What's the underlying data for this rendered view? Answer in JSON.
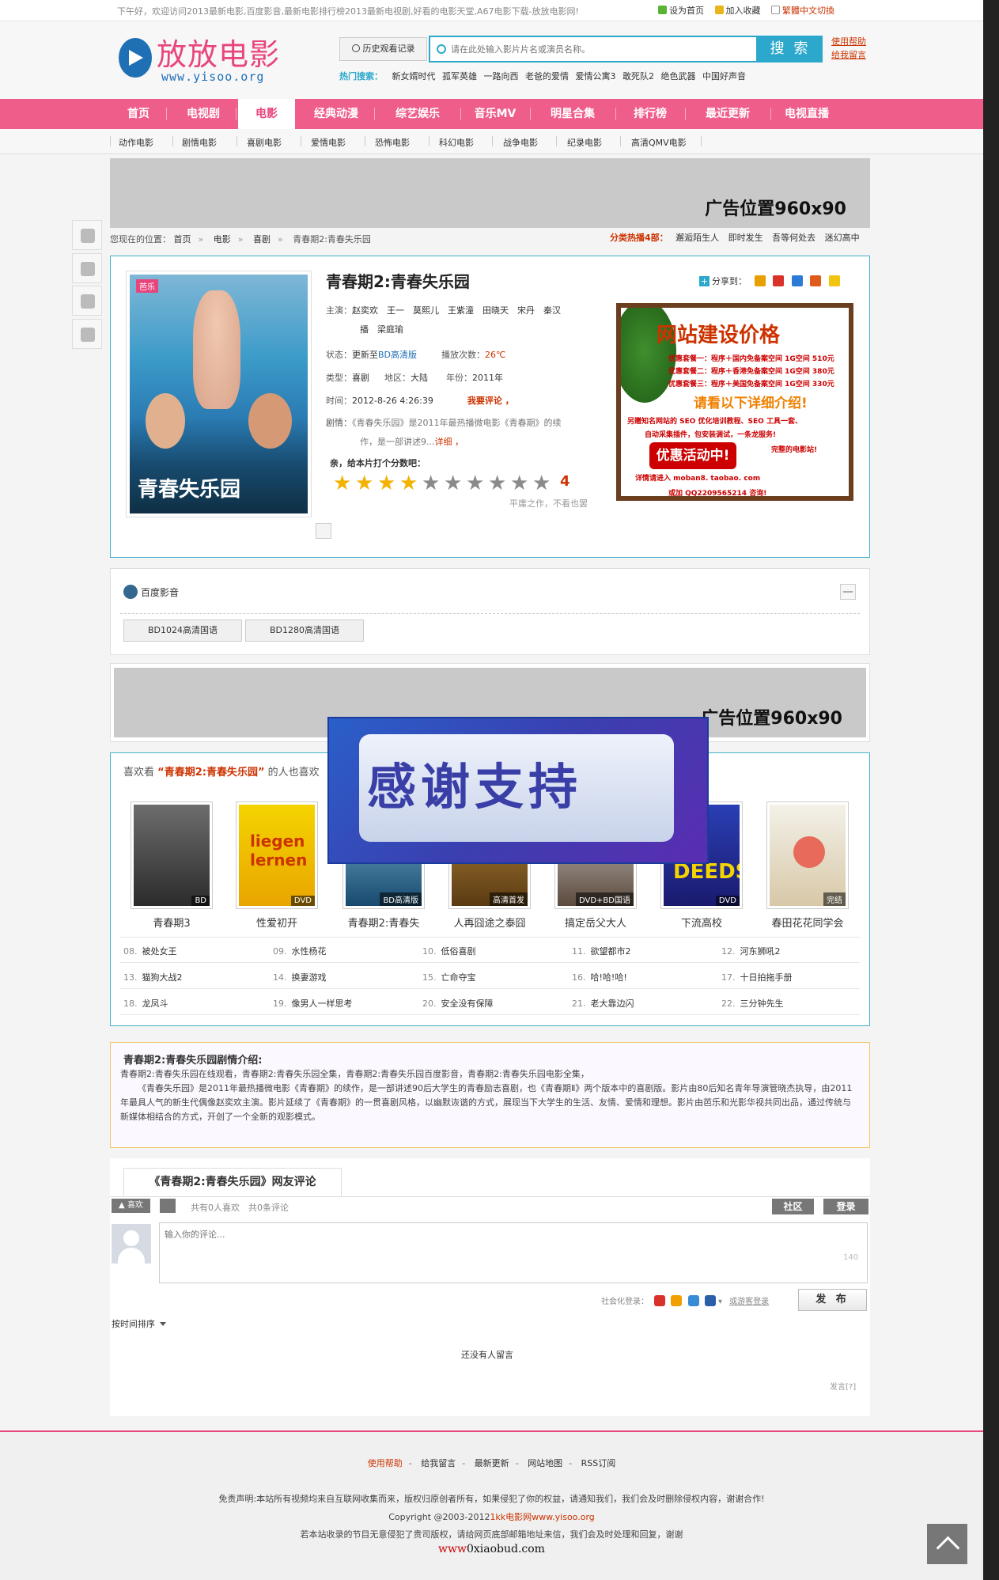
{
  "topbar": {
    "greeting": "下午好，欢迎访问2013最新电影,百度影音,最新电影排行榜2013最新电视剧,好看的电影天堂,A67电影下载-放放电影网!",
    "set_home": "设为首页",
    "add_fav": "加入收藏",
    "trad": "繁體中文切換"
  },
  "header": {
    "logo_name": "放放电影",
    "logo_url": "www.yisoo.org",
    "history_label": "历史观看记录",
    "search_placeholder": "请在此处输入影片片名或演员名称。",
    "search_button": "搜 索",
    "help": "使用帮助",
    "feedback": "给我留言",
    "hot_label": "热门搜索：",
    "hot_keywords": [
      "新女婿时代",
      "孤军英雄",
      "一路向西",
      "老爸的爱情",
      "爱情公寓3",
      "敢死队2",
      "绝色武器",
      "中国好声音"
    ]
  },
  "nav": {
    "items": [
      "首页",
      "电视剧",
      "电影",
      "经典动漫",
      "综艺娱乐",
      "音乐MV",
      "明星合集",
      "排行榜",
      "最近更新",
      "电视直播"
    ],
    "active": "电影"
  },
  "subnav": [
    "动作电影",
    "剧情电影",
    "喜剧电影",
    "爱情电影",
    "恐怖电影",
    "科幻电影",
    "战争电影",
    "纪录电影",
    "高清QMV电影"
  ],
  "ads": {
    "banner_text": "广告位置960x90"
  },
  "breadcrumb": {
    "prefix": "您现在的位置：",
    "items": [
      "首页",
      "电影",
      "喜剧",
      "青春期2:青春失乐园"
    ]
  },
  "hot_category": {
    "label": "分类热播4部：",
    "items": [
      "邂逅陌生人",
      "即时发生",
      "吾等何处去",
      "迷幻高中"
    ]
  },
  "movie": {
    "title": "青春期2:青春失乐园",
    "poster_title": "青春失乐园",
    "poster_badge": "芭乐",
    "share_label": "分享到：",
    "cast_label": "主演：",
    "cast_line1": "赵奕欢　王一　莫熙儿　王紫潼　田晓天　宋丹　秦汉",
    "cast_line2": "播　梁庭瑜",
    "status_label": "状态：",
    "status_prefix": "更新至",
    "status_value": "BD高清版",
    "plays_label": "播放次数：",
    "plays_value": "26℃",
    "type_label": "类型：",
    "type_value": "喜剧",
    "region_label": "地区：",
    "region_value": "大陆",
    "year_label": "年份：",
    "year_value": "2011年",
    "time_label": "时间：",
    "time_value": "2012-8-26 4:26:39",
    "comment_action": "我要评论 ，",
    "plot_label": "剧情：",
    "plot_short1": "《青春失乐园》是2011年最热播微电影《青春期》的续",
    "plot_short2": "作，是一部讲述9...",
    "detail_link": "详细 ，",
    "rate_prompt": "亲，给本片打个分数吧：",
    "rating": 4,
    "rating_max": 10,
    "score": "4",
    "rating_hint": "平庸之作，不看也罢"
  },
  "side_ad": {
    "headline": "网站建设价格",
    "lines": [
      "优惠套餐一：程序＋国内免备案空间 1G空间 510元",
      "优惠套餐二：程序＋香港免备案空间 1G空间 380元",
      "优惠套餐三：程序＋美国免备案空间 1G空间 330元"
    ],
    "headline2": "请看以下详细介绍!",
    "line4": "另赠知名网站的 SEO 优化培训教程、SEO 工具一套、",
    "line5": "自动采集插件，包安装调试，一条龙服务!",
    "burst": "优惠活动中!",
    "line6": "完整的电影站!",
    "line7": "详情请进入 moban8. taobao. com",
    "line8": "或加 QQ2209565214 咨询!"
  },
  "player": {
    "source_name": "百度影音",
    "collapse": "—",
    "sources": [
      "BD1024高清国语",
      "BD1280高清国语"
    ]
  },
  "overlay": {
    "text": "感谢支持"
  },
  "related": {
    "title_prefix": "喜欢看",
    "title_movie": "“青春期2:青春失乐园”",
    "title_suffix": "的人也喜欢",
    "posters": [
      {
        "name": "青春期3",
        "tag": "BD"
      },
      {
        "name": "性爱初开",
        "tag": "DVD"
      },
      {
        "name": "青春期2:青春失",
        "tag": "BD高清版"
      },
      {
        "name": "人再囧途之泰囧",
        "tag": "高清首发"
      },
      {
        "name": "搞定岳父大人",
        "tag": "DVD+BD国语"
      },
      {
        "name": "下流高校",
        "tag": "DVD"
      },
      {
        "name": "春田花花同学会",
        "tag": "完结"
      }
    ],
    "list": [
      {
        "n": "08.",
        "t": "被处女王"
      },
      {
        "n": "09.",
        "t": "水性杨花"
      },
      {
        "n": "10.",
        "t": "低俗喜剧"
      },
      {
        "n": "11.",
        "t": "欲望都市2"
      },
      {
        "n": "12.",
        "t": "河东狮吼2"
      },
      {
        "n": "13.",
        "t": "猫狗大战2"
      },
      {
        "n": "14.",
        "t": "换妻游戏"
      },
      {
        "n": "15.",
        "t": "亡命夺宝"
      },
      {
        "n": "16.",
        "t": "哈!哈!哈!"
      },
      {
        "n": "17.",
        "t": "十日拍拖手册"
      },
      {
        "n": "18.",
        "t": "龙凤斗"
      },
      {
        "n": "19.",
        "t": "像男人一样思考"
      },
      {
        "n": "20.",
        "t": "安全没有保障"
      },
      {
        "n": "21.",
        "t": "老大靠边闪"
      },
      {
        "n": "22.",
        "t": "三分钟先生"
      }
    ]
  },
  "plot": {
    "title": "青春期2:青春失乐园剧情介绍:",
    "line1": "青春期2:青春失乐园在线观看，青春期2:青春失乐园全集，青春期2:青春失乐园百度影音，青春期2:青春失乐园电影全集，",
    "line2": "《青春失乐园》是2011年最热播微电影《青春期》的续作，是一部讲述90后大学生的青春励志喜剧，也《青春期Ⅱ》两个版本中的喜剧版。影片由80后知名青年导演管晓杰执导，由2011年最具人气的新生代偶像赵奕欢主演。影片延续了《青春期》的一贯喜剧风格，以幽默诙谐的方式，展现当下大学生的生活、友情、爱情和理想。影片由芭乐和光影华视共同出品，通过传统与新媒体相结合的方式，开创了一个全新的观影模式。"
  },
  "comments": {
    "tab": "《青春期2:青春失乐园》网友评论",
    "like": "喜欢",
    "stats": "共有0人喜欢　共0条评论",
    "community": "社区",
    "login": "登录",
    "placeholder": "输入你的评论...",
    "count": "140",
    "social_label": "社会化登录：",
    "guest_link": "或游客登录",
    "post": "发 布",
    "sort": "按时间排序",
    "empty": "还没有人留言",
    "powered": "发言[?]"
  },
  "footer": {
    "links": [
      "使用帮助",
      "给我留言",
      "最新更新",
      "网站地图",
      "RSS订阅"
    ],
    "disclaimer": "免责声明:本站所有视频均来自互联网收集而来，版权归原创者所有，如果侵犯了你的权益，请通知我们，我们会及时删除侵权内容，谢谢合作!",
    "copyright_prefix": "Copyright @2003-2012",
    "copyright_link": "1kk电影网www.yisoo.org",
    "notice": "若本站收录的节目无意侵犯了贵司版权，请给网页底部邮箱地址来信，我们会及时处理和回复，谢谢",
    "brand_prefix": "www",
    "brand_rest": "0xiaobud.com"
  },
  "colors": {
    "accent": "#ef5d8b",
    "teal": "#2ca8cc",
    "red": "#cc3300",
    "border": "#43b3c9"
  },
  "icons": [
    "update-icon",
    "bookmark-icon",
    "doc-icon",
    "search-icon",
    "clock-icon",
    "up-arrow-icon",
    "list-icon",
    "paw-icon",
    "chat-icon",
    "plus-icon",
    "star-icon",
    "thumb-up-icon",
    "flag-icon",
    "avatar-icon",
    "back-to-top-icon"
  ]
}
